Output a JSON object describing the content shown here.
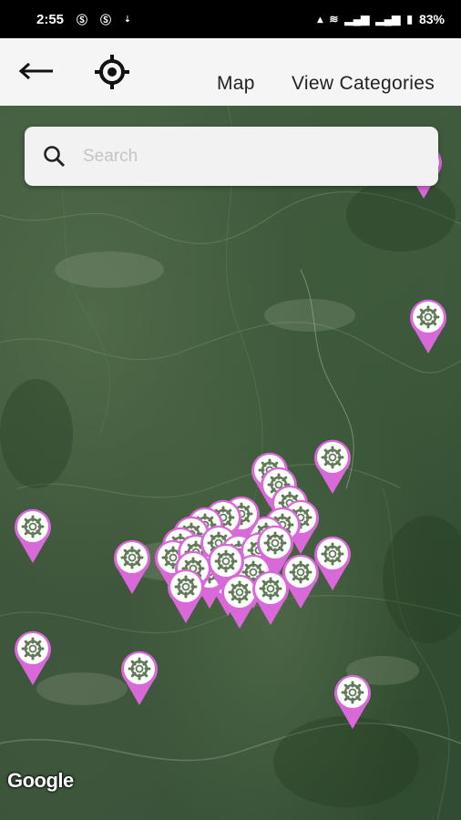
{
  "status_bar": {
    "time": "2:55",
    "battery": "83%"
  },
  "app_bar": {
    "tabs": [
      {
        "label": "Map"
      },
      {
        "label": "View Categories"
      }
    ]
  },
  "search": {
    "placeholder": "Search",
    "value": ""
  },
  "map": {
    "attribution": "Google",
    "pin_color": "#d968d9",
    "pin_icon": "gear-icon"
  }
}
